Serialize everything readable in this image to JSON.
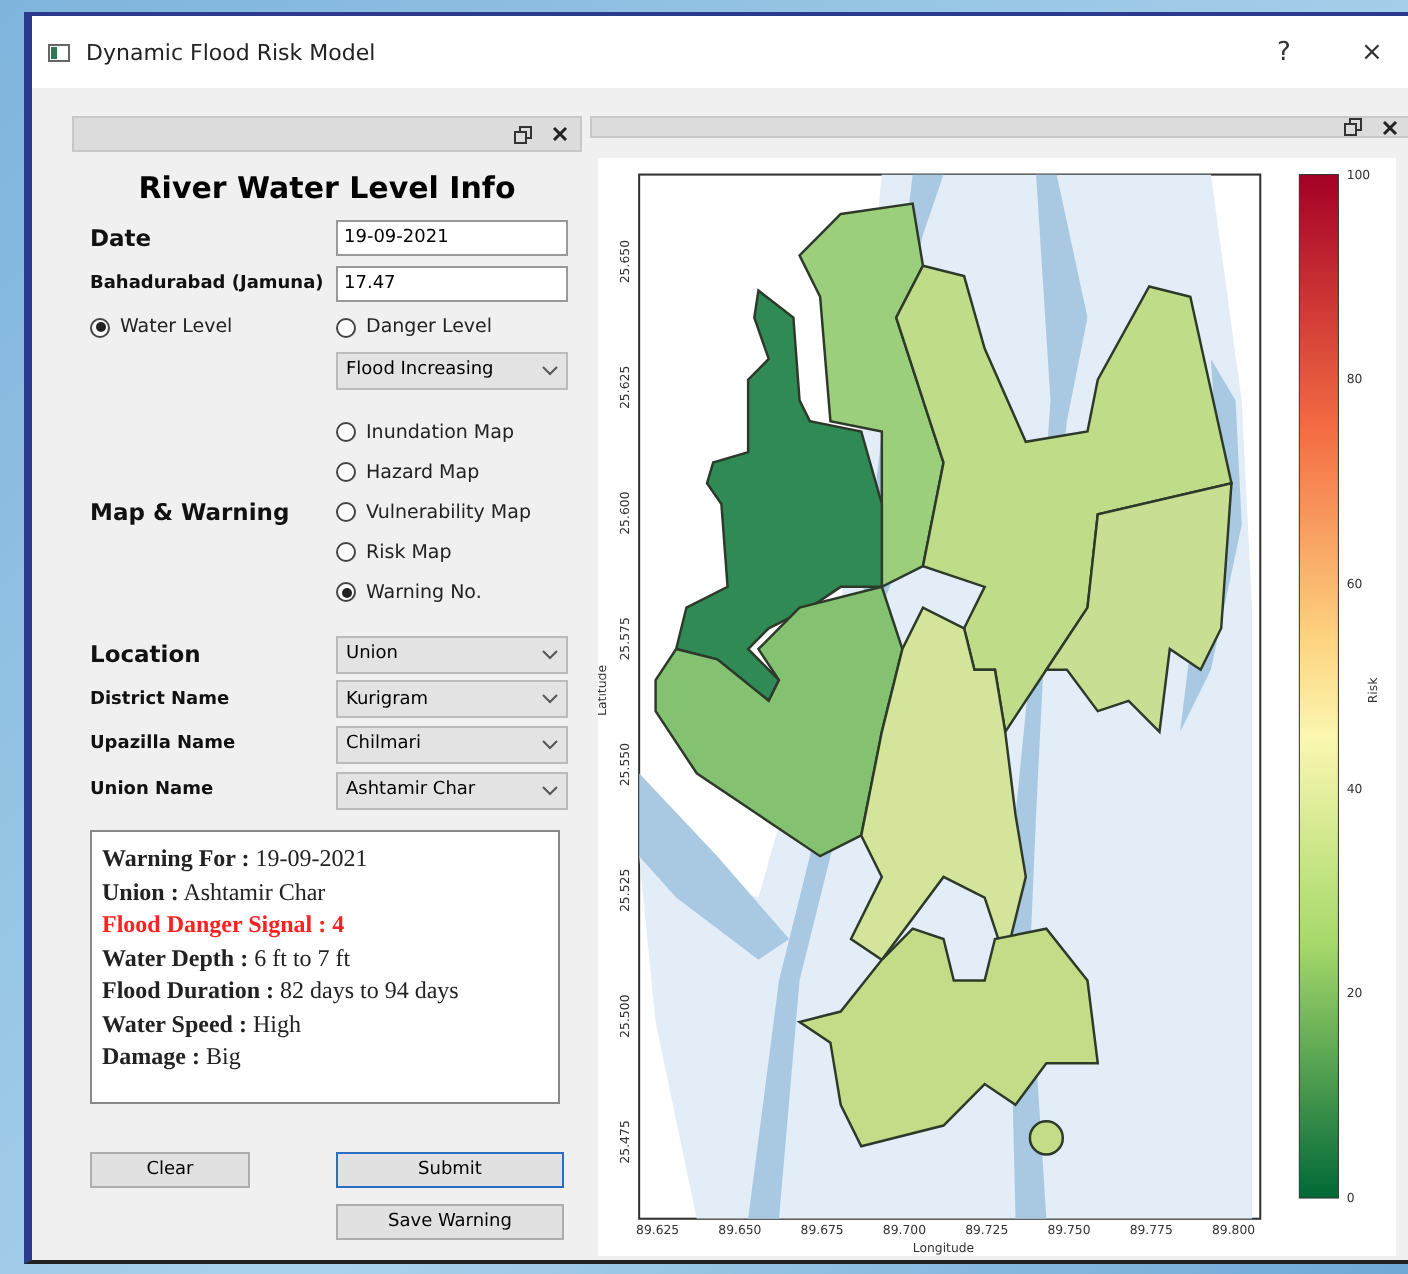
{
  "window": {
    "title": "Dynamic Flood Risk Model",
    "help": "?",
    "close": "×"
  },
  "form": {
    "heading": "River Water Level Info",
    "date": {
      "label": "Date",
      "value": "19-09-2021"
    },
    "station": {
      "label": "Bahadurabad (Jamuna)",
      "value": "17.47"
    },
    "level_type": [
      {
        "label": "Water Level",
        "selected": true
      },
      {
        "label": "Danger Level",
        "selected": false
      }
    ],
    "trend": {
      "value": "Flood Increasing"
    },
    "map_section": {
      "label": "Map & Warning",
      "options": [
        {
          "label": "Inundation Map",
          "selected": false
        },
        {
          "label": "Hazard Map",
          "selected": false
        },
        {
          "label": "Vulnerability Map",
          "selected": false
        },
        {
          "label": "Risk Map",
          "selected": false
        },
        {
          "label": "Warning No.",
          "selected": true
        }
      ]
    },
    "selects": [
      {
        "label": "Location",
        "value": "Union",
        "major": true
      },
      {
        "label": "District Name",
        "value": "Kurigram",
        "major": false
      },
      {
        "label": "Upazilla Name",
        "value": "Chilmari",
        "major": false
      },
      {
        "label": "Union Name",
        "value": "Ashtamir Char",
        "major": false
      }
    ]
  },
  "warning": {
    "lines": [
      {
        "label": "Warning For :",
        "value": "19-09-2021",
        "alert": false
      },
      {
        "label": "Union :",
        "value": "Ashtamir Char",
        "alert": false
      },
      {
        "label": "Flood Danger Signal :",
        "value": "4",
        "alert": true
      },
      {
        "label": "Water Depth :",
        "value": "6 ft to 7 ft",
        "alert": false
      },
      {
        "label": "Flood Duration :",
        "value": "82 days to 94 days",
        "alert": false
      },
      {
        "label": "Water Speed :",
        "value": "High",
        "alert": false
      },
      {
        "label": "Damage :",
        "value": "Big",
        "alert": false
      }
    ]
  },
  "buttons": [
    {
      "label": "Clear",
      "focused": false
    },
    {
      "label": "Submit",
      "focused": true
    },
    {
      "label": "Save Warning",
      "focused": false
    }
  ],
  "map": {
    "xlabel": "Longitude",
    "ylabel": "Latitude",
    "xticks": [
      "89.625",
      "89.650",
      "89.675",
      "89.700",
      "89.725",
      "89.750",
      "89.775",
      "89.800"
    ],
    "yticks": [
      "25.650",
      "25.625",
      "25.600",
      "25.575",
      "25.550",
      "25.525",
      "25.500",
      "25.475"
    ],
    "colorbar": {
      "label": "Risk",
      "ticks": [
        "100",
        "80",
        "60",
        "40",
        "20",
        "0"
      ]
    }
  }
}
